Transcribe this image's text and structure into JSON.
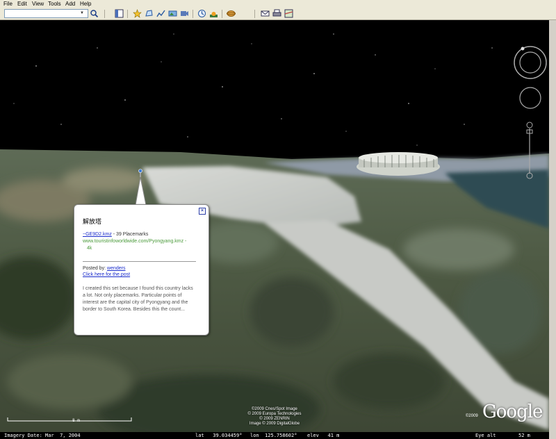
{
  "menu": {
    "items": [
      "File",
      "Edit",
      "View",
      "Tools",
      "Add",
      "Help"
    ]
  },
  "toolbar": {
    "search_value": "",
    "icons": [
      "search-icon",
      "sidebar-icon",
      "placemark-icon",
      "polygon-icon",
      "path-icon",
      "overlay-icon",
      "tour-icon",
      "history-icon",
      "sunlight-icon",
      "sky-icon",
      "email-icon",
      "print-icon",
      "maps-icon"
    ]
  },
  "balloon": {
    "title": "解放塔",
    "file_link": "~GE9D2.kmz",
    "placemark_count": "- 39 Placemarks",
    "source_url": "www.touristinfoworldwide.com/Pyongyang.kmz -",
    "size": "4k",
    "posted_by_label": "Posted by:",
    "posted_by_user": "wenders",
    "post_link": "Click here for the post",
    "description": "I created this set because I found this country lacks a lot. Not only placemarks. Particular points of interest are the capital city of Pyongyang and the border to South Korea. Besides this the count...",
    "close": "×"
  },
  "attribution": [
    "©2009 Cnes/Spot Image",
    "© 2009 Europa Technologies",
    "© 2009 ZENRIN",
    "Image © 2009 DigitalGlobe"
  ],
  "logo": {
    "text": "Google",
    "year": "©2009"
  },
  "scale": {
    "label": "8 m"
  },
  "status": {
    "imagery_date": "Imagery Date: Mar  7, 2004",
    "lat": "lat   39.034459°",
    "lon": "lon  125.758602°",
    "elev": "elev   41 m",
    "eye_alt_label": "Eye alt",
    "eye_alt_value": "52 m"
  },
  "colors": {
    "chrome": "#ece9d8",
    "sky": "#000000",
    "link": "#1a2ccc",
    "url_green": "#4a9a3a"
  }
}
